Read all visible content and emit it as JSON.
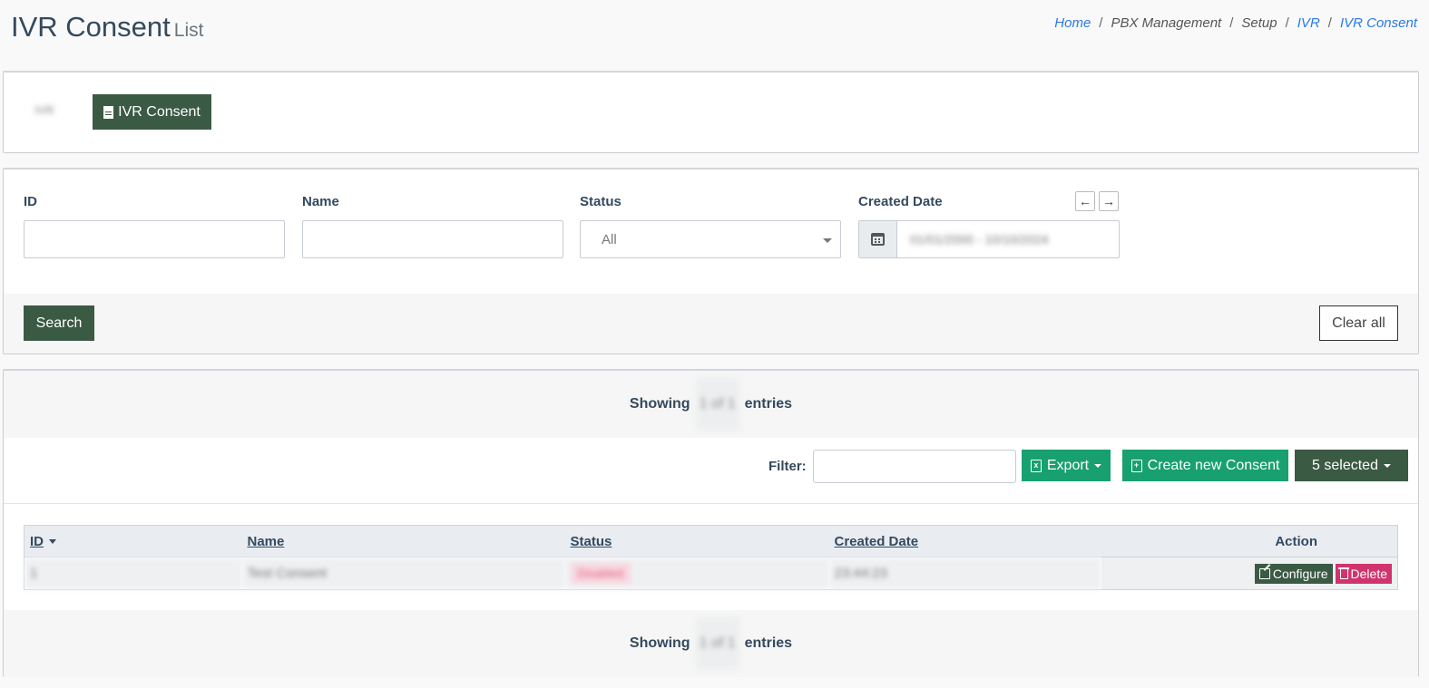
{
  "header": {
    "title": "IVR Consent",
    "subtitle": "List",
    "breadcrumb": [
      "Home",
      "PBX Management",
      "Setup",
      "IVR",
      "IVR Consent"
    ]
  },
  "tabs": {
    "ghost_label": "IVR",
    "active_label": "IVR Consent"
  },
  "filters": {
    "id_label": "ID",
    "name_label": "Name",
    "status_label": "Status",
    "status_value": "All",
    "created_label": "Created Date",
    "date_range": "01/01/2000 - 10/10/2024",
    "prev_arrow": "←",
    "next_arrow": "→",
    "search_label": "Search",
    "clear_label": "Clear all"
  },
  "list": {
    "showing_prefix": "Showing",
    "showing_count": "1 of 1",
    "showing_suffix": "entries",
    "filter_label": "Filter:",
    "export_label": "Export",
    "create_label": "Create new Consent",
    "selected_label": "5 selected",
    "columns": [
      "ID",
      "Name",
      "Status",
      "Created Date",
      "Action"
    ],
    "rows": [
      {
        "id": "1",
        "name": "Test Consent",
        "status": "Disabled",
        "created": "23:44:23"
      }
    ],
    "configure_label": "Configure",
    "delete_label": "Delete"
  },
  "colors": {
    "primary_dark": "#3b5a44",
    "accent_green": "#18a070",
    "danger": "#d0346e",
    "link": "#2a7ae2"
  }
}
